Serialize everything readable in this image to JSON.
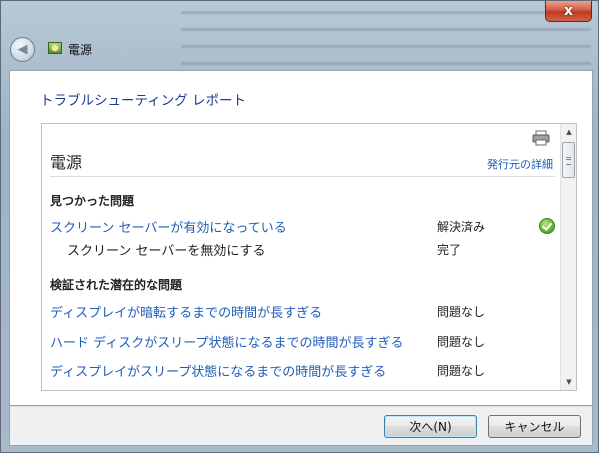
{
  "window": {
    "title": "電源",
    "close_label": "x"
  },
  "page": {
    "heading": "トラブルシューティング レポート"
  },
  "report": {
    "title": "電源",
    "publisher_link": "発行元の詳細",
    "sections": [
      {
        "heading": "見つかった問題",
        "rows": [
          {
            "name": "スクリーン セーバーが有効になっている",
            "status": "解決済み",
            "icon": "check-icon",
            "kind": "link"
          },
          {
            "name": "スクリーン セーバーを無効にする",
            "status": "完了",
            "kind": "sub"
          }
        ]
      },
      {
        "heading": "検証された潜在的な問題",
        "rows": [
          {
            "name": "ディスプレイが暗転するまでの時間が長すぎる",
            "status": "問題なし",
            "kind": "link"
          },
          {
            "name": "ハード ディスクがスリープ状態になるまでの時間が長すぎる",
            "status": "問題なし",
            "kind": "link"
          },
          {
            "name": "ディスプレイがスリープ状態になるまでの時間が長すぎる",
            "status": "問題なし",
            "kind": "link"
          }
        ]
      }
    ]
  },
  "footer": {
    "next_label": "次へ(N)",
    "cancel_label": "キャンセル"
  },
  "colors": {
    "link": "#1f5eb7",
    "heading": "#1c3c8c"
  }
}
